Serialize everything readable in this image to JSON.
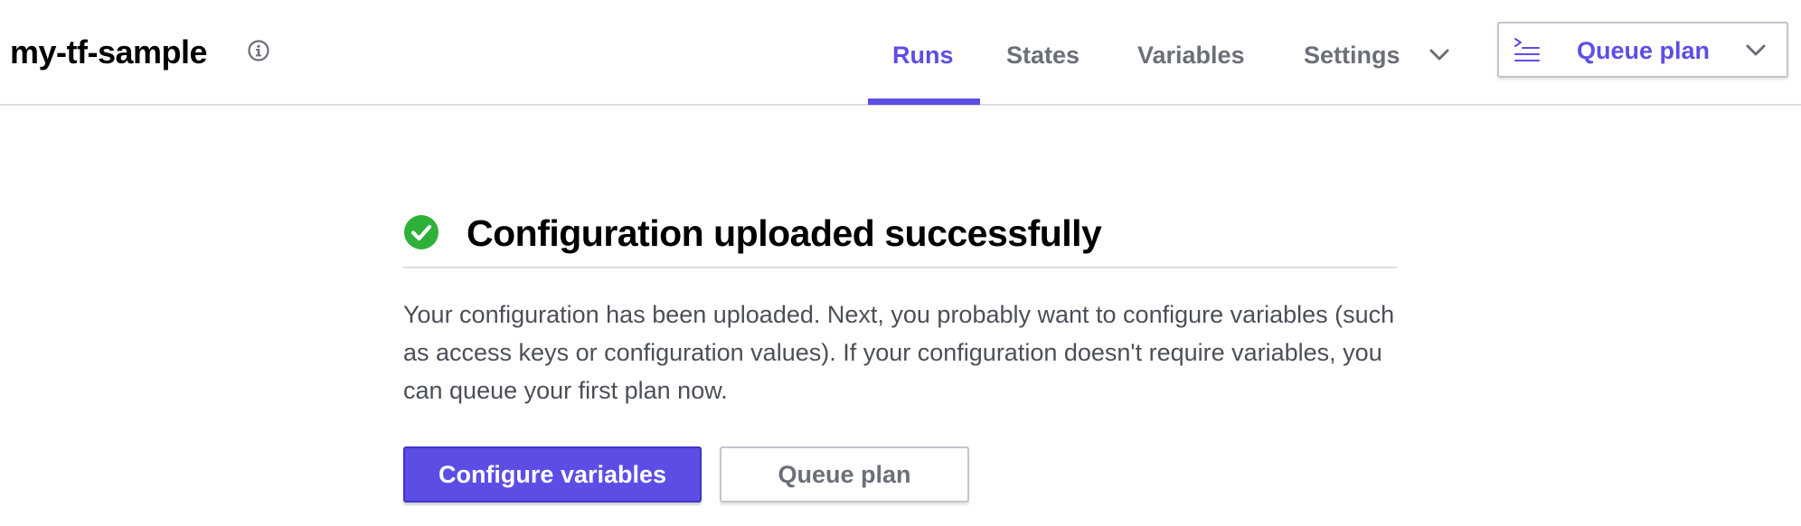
{
  "header": {
    "workspace_title": "my-tf-sample",
    "info_icon": "info-circle-icon",
    "tabs": [
      {
        "label": "Runs",
        "active": true
      },
      {
        "label": "States",
        "active": false
      },
      {
        "label": "Variables",
        "active": false
      },
      {
        "label": "Settings",
        "active": false
      }
    ],
    "queue_dropdown": {
      "label": "Queue plan",
      "icon": "terminal-icon"
    }
  },
  "main": {
    "heading": "Configuration uploaded successfully",
    "description": "Your configuration has been uploaded. Next, you probably want to configure variables (such as access keys or configuration values). If your configuration doesn't require variables, you can queue your first plan now.",
    "primary_button": "Configure variables",
    "secondary_button": "Queue plan"
  },
  "colors": {
    "accent": "#5c4ee5",
    "success": "#2eb039",
    "muted_text": "#6b6f78",
    "body_text": "#4b4f57"
  }
}
